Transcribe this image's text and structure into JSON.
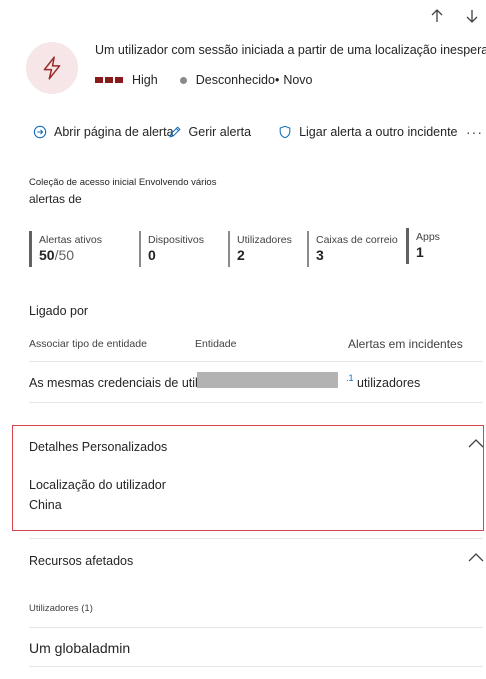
{
  "nav": {
    "up_icon": "arrow-up-icon",
    "down_icon": "arrow-down-icon"
  },
  "header": {
    "icon": "lightning-bolt-icon",
    "title": "Um utilizador com sessão iniciada a partir de uma localização inesperada",
    "severity": "High",
    "severity_color": "#8a1a1a",
    "status": "Desconhecido",
    "separator": "•",
    "classification": "Novo"
  },
  "toolbar": {
    "open_alert_page": "Abrir página de alerta",
    "manage_alert": "Gerir alerta",
    "link_alert": "Ligar alerta a outro incidente",
    "more": "···"
  },
  "collection": {
    "line1": "Coleção de acesso inicial Envolvendo vários",
    "line2": "alertas de"
  },
  "stats": [
    {
      "label": "Alertas ativos",
      "value": "50",
      "total": "/50"
    },
    {
      "label": "Dispositivos",
      "value": "0"
    },
    {
      "label": "Utilizadores",
      "value": "2"
    },
    {
      "label": "Caixas de correio",
      "value": "3"
    },
    {
      "label": "Apps",
      "value": "1"
    }
  ],
  "linked": {
    "title": "Ligado por",
    "headers": [
      "Associar tipo de entidade",
      "Entidade",
      "Alertas em incidentes"
    ],
    "row": {
      "type": "As mesmas credenciais de utilizador",
      "link": ".1",
      "count": "utilizadores"
    }
  },
  "custom_details": {
    "title": "Detalhes Personalizados",
    "field_label": "Localização do utilizador",
    "field_value": "China",
    "border_color": "#d9434e"
  },
  "affected": {
    "title": "Recursos afetados",
    "users_count": "Utilizadores (1)",
    "user_name": "Um globaladmin"
  }
}
